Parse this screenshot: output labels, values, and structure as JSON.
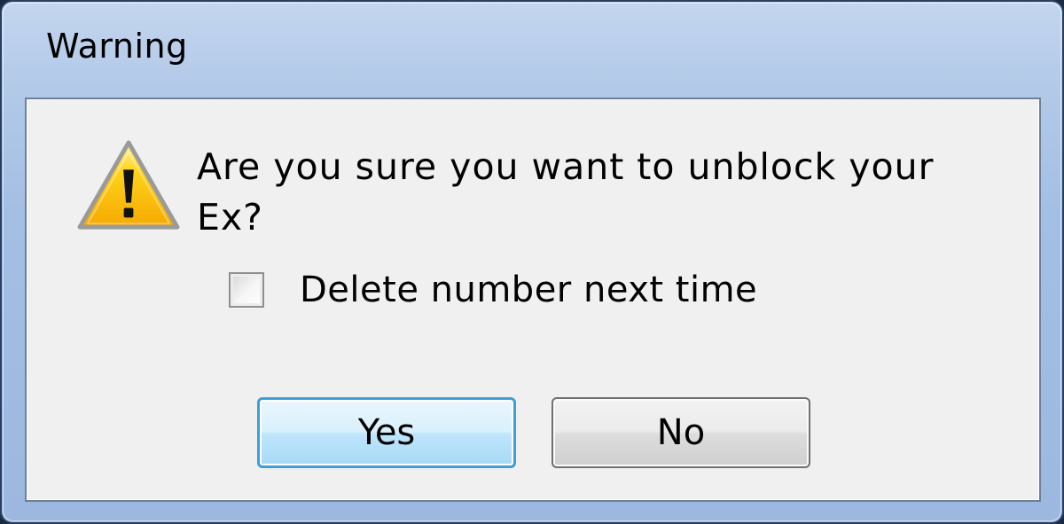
{
  "dialog": {
    "title": "Warning",
    "icon": "warning-icon",
    "message": "Are you sure you want to unblock your Ex?",
    "checkbox": {
      "label": "Delete number next time",
      "checked": false
    },
    "buttons": {
      "yes_label": "Yes",
      "no_label": "No"
    }
  },
  "colors": {
    "title_bar": "#a4bfe4",
    "client_background": "#f0f0f0",
    "default_button_border": "#3c9fd8",
    "warning_yellow": "#ffd21a"
  }
}
